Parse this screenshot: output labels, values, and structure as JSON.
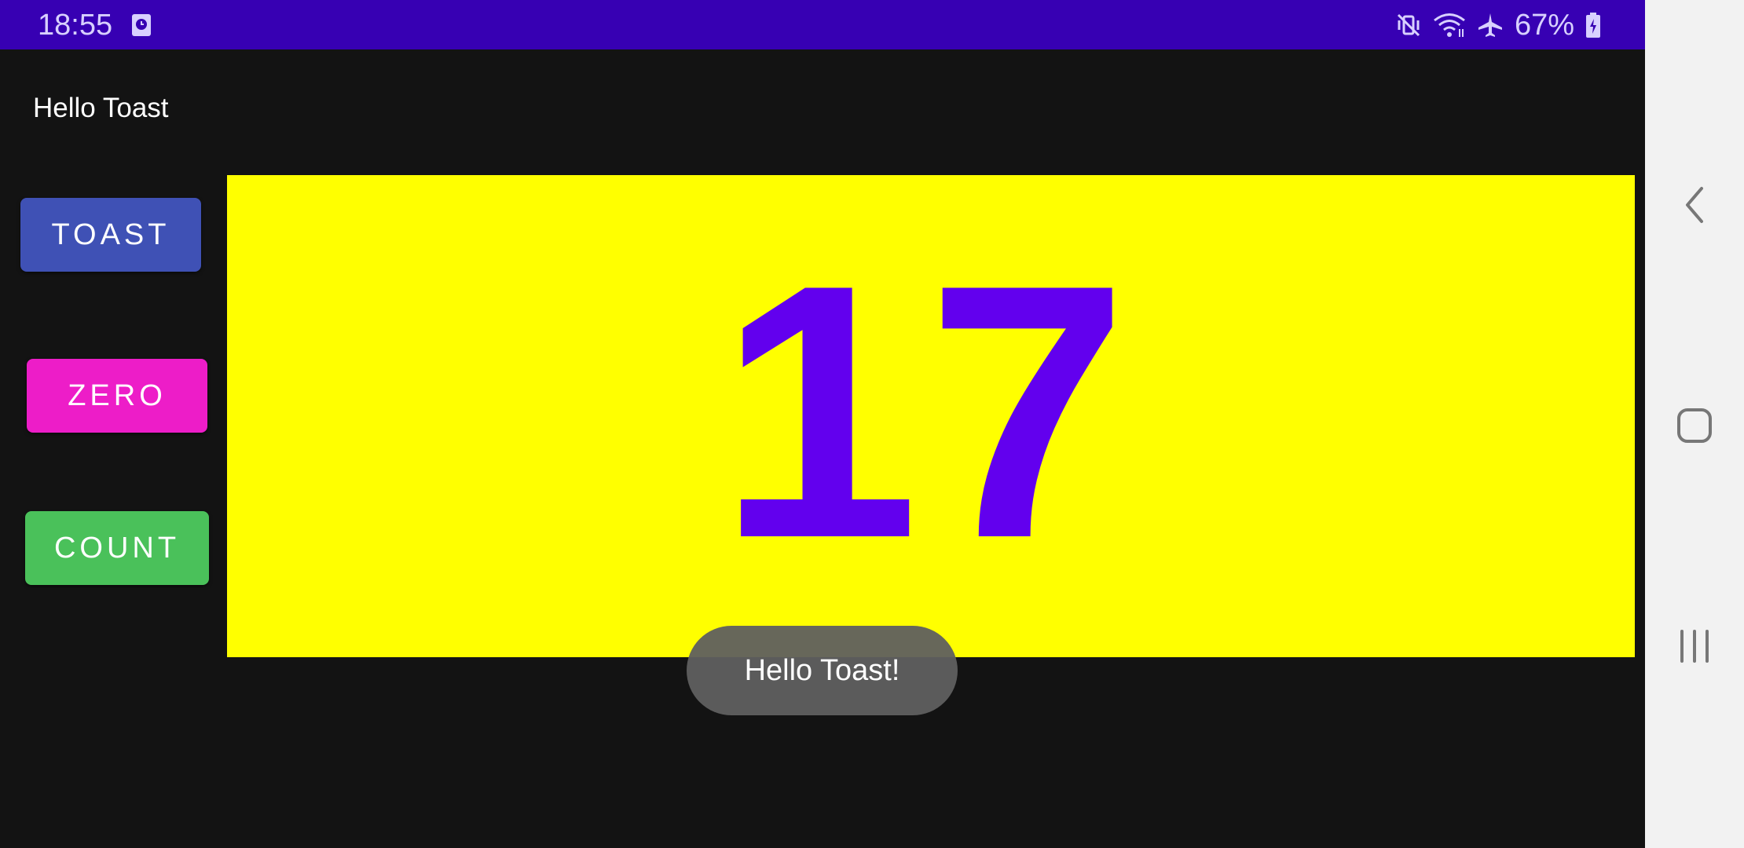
{
  "status_bar": {
    "time": "18:55",
    "battery": "67%",
    "icons": [
      "clock-notification-icon",
      "mute-vibrate-icon",
      "wifi-icon",
      "airplane-icon",
      "battery-charging-icon"
    ]
  },
  "app_bar": {
    "title": "Hello Toast"
  },
  "buttons": {
    "toast": "TOAST",
    "zero": "ZERO",
    "count": "COUNT"
  },
  "counter": {
    "value": "17"
  },
  "toast_message": "Hello Toast!",
  "colors": {
    "status_bar": "#3700b3",
    "background": "#131313",
    "toast_button": "#3f51b5",
    "zero_button": "#ed1dc8",
    "count_button": "#4ac15a",
    "count_panel": "#ffff00",
    "count_text": "#6200ee",
    "nav_bar": "#f2f2f2"
  },
  "nav_bar": {
    "icons": [
      "back-icon",
      "home-icon",
      "recents-icon"
    ]
  }
}
